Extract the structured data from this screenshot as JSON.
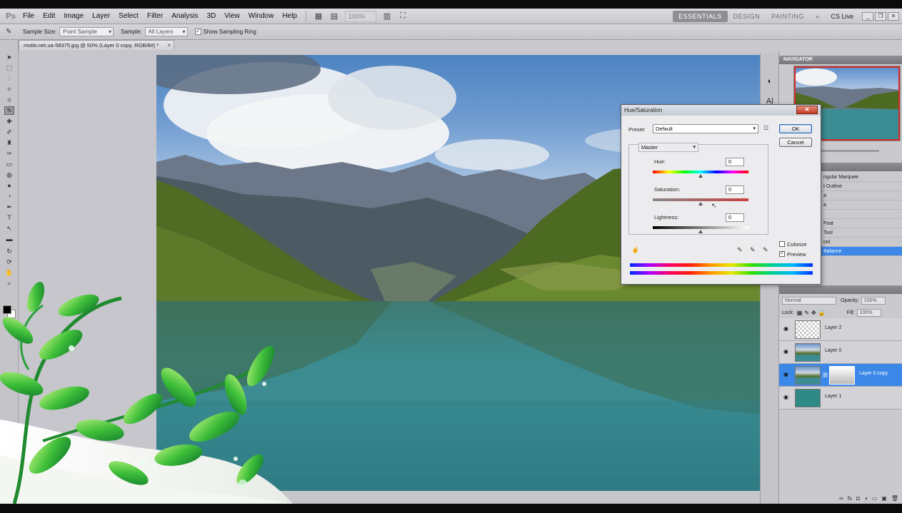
{
  "app": {
    "logo": "Ps",
    "menu": [
      "File",
      "Edit",
      "Image",
      "Layer",
      "Select",
      "Filter",
      "Analysis",
      "3D",
      "View",
      "Window",
      "Help"
    ],
    "zoom": "100%",
    "workspaces": [
      "ESSENTIALS",
      "DESIGN",
      "PAINTING"
    ],
    "more_workspaces": "»",
    "cs_live": "CS Live",
    "colors": {
      "accent": "#3c88e8",
      "dialog_close": "#c23a24"
    }
  },
  "options": {
    "sample_size_label": "Sample Size:",
    "sample_size_value": "Point Sample",
    "sample_label": "Sample:",
    "sample_value": "All Layers",
    "show_ring_label": "Show Sampling Ring",
    "show_ring_checked": "✓"
  },
  "document": {
    "tab_title": "motto.net.ua-58375.jpg @ 50% (Layer 0 copy, RGB/8#) *",
    "close": "×"
  },
  "hue_sat": {
    "title": "Hue/Saturation",
    "close": "✕",
    "preset_label": "Preset:",
    "preset_value": "Default",
    "preset_options_icon": "preset-options-icon",
    "channel": "Master",
    "hue_label": "Hue:",
    "hue_value": "0",
    "saturation_label": "Saturation:",
    "saturation_value": "0",
    "lightness_label": "Lightness:",
    "lightness_value": "0",
    "ok": "OK",
    "cancel": "Cancel",
    "colorize_label": "Colorize",
    "colorize_checked": "",
    "preview_label": "Preview",
    "preview_checked": "✓"
  },
  "panels": {
    "navigator_title": "NAVIGATOR",
    "history_items": [
      "ngular Marquee",
      "t Outline",
      "a",
      "",
      "Feat",
      "Tool",
      "ool",
      "Balance"
    ],
    "history_selected_index": 7,
    "layers": {
      "blend_mode": "Normal",
      "opacity_label": "Opacity:",
      "opacity_value": "100%",
      "lock_label": "Lock:",
      "fill_label": "Fill:",
      "fill_value": "100%",
      "items": [
        {
          "name": "Layer 2"
        },
        {
          "name": "Layer 0"
        },
        {
          "name": "Layer 0 copy"
        },
        {
          "name": "Layer 1"
        }
      ],
      "selected": "Layer 0 copy"
    }
  }
}
